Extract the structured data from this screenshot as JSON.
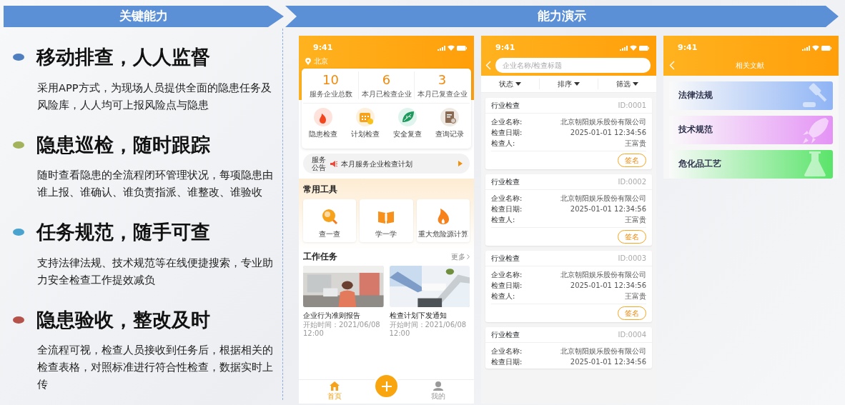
{
  "banners": [
    {
      "label": "关键能力"
    },
    {
      "label": "能力演示"
    }
  ],
  "features": [
    {
      "title": "移动排查，人人监督",
      "description": "采用APP方式，为现场人员提供全面的隐患任务及风险库，人人均可上报风险点与隐患",
      "color": "#4f7fbf"
    },
    {
      "title": "隐患巡检，随时跟踪",
      "description": "随时查看隐患的全流程闭环管理状况，每项隐患由谁上报、谁确认、谁负责指派、谁整改、谁验收",
      "color": "#a3b35b"
    },
    {
      "title": "任务规范，随手可查",
      "description": "支持法律法规、技术规范等在线便捷搜索，专业助力安全检查工作提效减负",
      "color": "#4aa3cf"
    },
    {
      "title": "隐患验收，整改及时",
      "description": "全流程可视，检查人员接收到任务后，根据相关的检查表格，对照标准进行符合性检查，数据实时上传",
      "color": "#b5524a"
    }
  ],
  "home_screen": {
    "time": "9:41",
    "location": "北京",
    "stats": [
      {
        "value": "10",
        "label": "服务企业总数"
      },
      {
        "value": "6",
        "label": "本月已检查企业"
      },
      {
        "value": "3",
        "label": "本月已复查企业"
      }
    ],
    "shortcuts": [
      {
        "label": "隐患检查"
      },
      {
        "label": "计划检查"
      },
      {
        "label": "安全复查"
      },
      {
        "label": "查询记录"
      }
    ],
    "notice": {
      "tag": "服务公告",
      "text": "本月服务企业检查计划"
    },
    "tools_title": "常用工具",
    "tools": [
      {
        "label": "查一查"
      },
      {
        "label": "学一学"
      },
      {
        "label": "重大危险源计算"
      }
    ],
    "tasks_title": "工作任务",
    "more": "更多",
    "tasks": [
      {
        "title": "企业行为准则报告",
        "time": "开始时间：2021/06/08  12:00"
      },
      {
        "title": "检查计划下发通知",
        "time": "开始时间：2021/06/08  12:00"
      }
    ],
    "nav": [
      {
        "label": "首页",
        "selected": true
      },
      {
        "label": "我的",
        "selected": false
      }
    ]
  },
  "list_screen": {
    "time": "9:41",
    "search": {
      "placeholder": "企业名称/检查标题"
    },
    "filters": [
      {
        "label": "状态"
      },
      {
        "label": "排序"
      },
      {
        "label": "筛选"
      }
    ],
    "records": [
      {
        "type": "行业检查",
        "id": "ID:0001",
        "fields": [
          {
            "label": "企业名称:",
            "value": "北京朝阳娱乐股份有限公司"
          },
          {
            "label": "检查日期:",
            "value": "2025-01-01 12:34:56"
          },
          {
            "label": "检查人:",
            "value": "王富贵"
          }
        ],
        "button": "签名"
      },
      {
        "type": "行业检查",
        "id": "ID:0002",
        "fields": [
          {
            "label": "企业名称:",
            "value": "北京朝阳娱乐股份有限公司"
          },
          {
            "label": "检查日期:",
            "value": "2025-01-01 12:34:56"
          },
          {
            "label": "检查人:",
            "value": "王富贵"
          }
        ],
        "button": "签名"
      },
      {
        "type": "行业检查",
        "id": "ID:0003",
        "fields": [
          {
            "label": "企业名称:",
            "value": "北京朝阳娱乐股份有限公司"
          },
          {
            "label": "检查日期:",
            "value": "2025-01-01 12:34:56"
          },
          {
            "label": "检查人:",
            "value": "王富贵"
          }
        ],
        "button": "签名"
      },
      {
        "type": "行业检查",
        "id": "ID:0004",
        "fields": [
          {
            "label": "企业名称:",
            "value": "北京朝阳娱乐股份有限公司"
          },
          {
            "label": "检查日期:",
            "value": "2025-01-01 12:34:56"
          }
        ]
      }
    ]
  },
  "docs_screen": {
    "time": "9:41",
    "title": "相关文献",
    "docs": [
      {
        "label": "法律法规",
        "color": "#8fb4f5"
      },
      {
        "label": "技术规范",
        "color": "#e493f5"
      },
      {
        "label": "危化品工艺",
        "color": "#5ae46a"
      }
    ]
  }
}
